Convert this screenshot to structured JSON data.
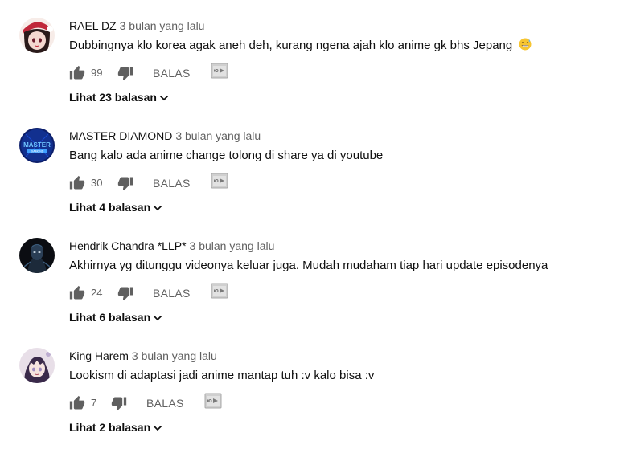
{
  "comments": [
    {
      "author": "RAEL DZ",
      "time": "3 bulan yang lalu",
      "text": "Dubbingnya klo korea agak aneh deh, kurang ngena ajah klo anime gk bhs Jepang",
      "emoji": "grinning-sweat-emoji",
      "likes": "99",
      "reply_label": "BALAS",
      "replies_label": "Lihat 23 balasan",
      "avatar_icon": "anime-girl-santa-hat-avatar",
      "avatar_colors": [
        "#f4d8d0",
        "#c0283a",
        "#2a1a1a"
      ]
    },
    {
      "author": "MASTER DIAMOND",
      "time": "3 bulan yang lalu",
      "text": "Bang kalo ada anime change tolong di share ya di youtube",
      "likes": "30",
      "reply_label": "BALAS",
      "replies_label": "Lihat 4 balasan",
      "avatar_icon": "master-diamond-logo-avatar",
      "avatar_colors": [
        "#0d1f6b",
        "#3fa0ff",
        "#ffffff"
      ]
    },
    {
      "author": "Hendrik Chandra *LLP*",
      "time": "3 bulan yang lalu",
      "text": "Akhirnya yg ditunggu videonya keluar juga. Mudah mudaham tiap hari update episodenya",
      "likes": "24",
      "reply_label": "BALAS",
      "replies_label": "Lihat 6 balasan",
      "avatar_icon": "dark-character-avatar",
      "avatar_colors": [
        "#0b0d12",
        "#3a5a7a",
        "#c7d4e0"
      ]
    },
    {
      "author": "King Harem",
      "time": "3 bulan yang lalu",
      "text": "Lookism di adaptasi jadi anime mantap tuh :v kalo bisa :v",
      "likes": "7",
      "reply_label": "BALAS",
      "replies_label": "Lihat 2 balasan",
      "avatar_icon": "anime-character-avatar",
      "avatar_colors": [
        "#e8dfe8",
        "#3a2a4a",
        "#a08cc0"
      ]
    }
  ],
  "icons": {
    "like": "thumbs-up-icon",
    "dislike": "thumbs-down-icon",
    "extension": "translate-extension-icon",
    "expand": "chevron-down-icon"
  },
  "colors": {
    "text_primary": "#0f0f0f",
    "text_secondary": "#606060",
    "icon": "#606060"
  }
}
